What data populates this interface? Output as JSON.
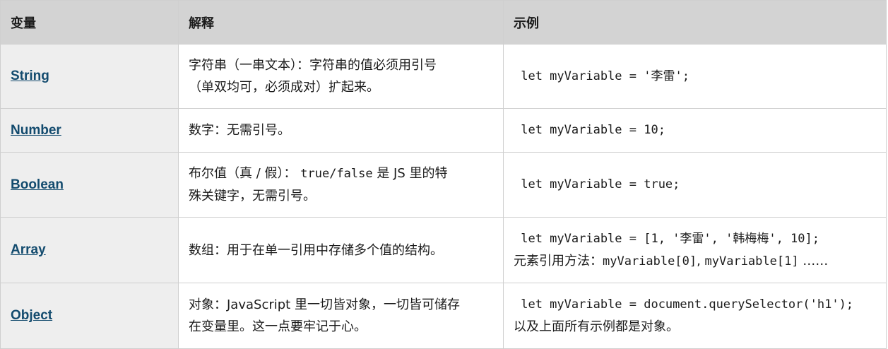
{
  "table": {
    "headers": {
      "variable": "变量",
      "explanation": "解释",
      "example": "示例"
    },
    "rows": [
      {
        "name": "String",
        "desc_line1": "字符串（一串文本）：字符串的值必须用引号",
        "desc_line2": "（单双均可，必须成对）扩起来。",
        "example_code": " let myVariable = '李雷';"
      },
      {
        "name": "Number",
        "desc": "数字：无需引号。",
        "example_code": " let myVariable = 10;"
      },
      {
        "name": "Boolean",
        "desc_prefix": "布尔值（真 / 假）：",
        "desc_code": "true/false",
        "desc_suffix": " 是 JS 里的特",
        "desc_line2": "殊关键字，无需引号。",
        "example_code": " let myVariable = true;"
      },
      {
        "name": "Array",
        "desc": "数组：用于在单一引用中存储多个值的结构。",
        "example_code": " let myVariable = [1, '李雷', '韩梅梅', 10];",
        "example_line2_prefix": "元素引用方法：",
        "example_line2_code": "myVariable[0]",
        "example_line2_sep": ", ",
        "example_line2_code2": "myVariable[1]",
        "example_line2_suffix": " ……"
      },
      {
        "name": "Object",
        "desc_line1": "对象：JavaScript 里一切皆对象，一切皆可储存",
        "desc_line2": "在变量里。这一点要牢记于心。",
        "example_code": " let myVariable = document.querySelector('h1');",
        "example_line2": "以及上面所有示例都是对象。"
      }
    ]
  }
}
